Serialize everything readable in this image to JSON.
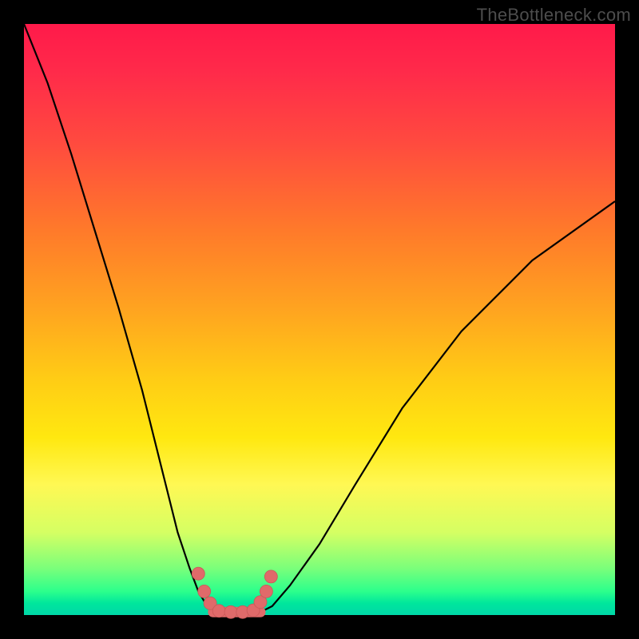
{
  "watermark": "TheBottleneck.com",
  "chart_data": {
    "type": "line",
    "title": "",
    "xlabel": "",
    "ylabel": "",
    "xlim": [
      0,
      100
    ],
    "ylim": [
      0,
      100
    ],
    "series": [
      {
        "name": "left-curve",
        "x": [
          0,
          4,
          8,
          12,
          16,
          20,
          24,
          26,
          28,
          29.5,
          31,
          32,
          33
        ],
        "values": [
          100,
          90,
          78,
          65,
          52,
          38,
          22,
          14,
          8,
          4,
          1.5,
          0.8,
          0.5
        ]
      },
      {
        "name": "right-curve",
        "x": [
          40,
          42,
          45,
          50,
          56,
          64,
          74,
          86,
          100
        ],
        "values": [
          0.5,
          1.5,
          5,
          12,
          22,
          35,
          48,
          60,
          70
        ]
      }
    ],
    "markers": {
      "name": "marker-dots",
      "x": [
        29.5,
        30.5,
        31.5,
        33,
        35,
        37,
        38.8,
        40,
        41,
        41.8
      ],
      "values": [
        7,
        4,
        2,
        0.7,
        0.5,
        0.5,
        0.8,
        2.2,
        4,
        6.5
      ]
    },
    "flat_segment": {
      "x0": 32,
      "x1": 40,
      "y": 0.5
    }
  },
  "colors": {
    "marker": "#e06a6a",
    "curve": "#000000"
  }
}
